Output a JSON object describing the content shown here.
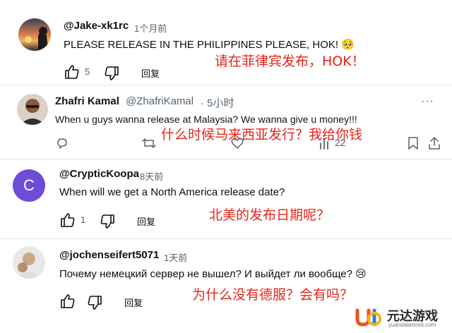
{
  "comments": [
    {
      "handle": "@Jake-xk1rc",
      "time": "1个月前",
      "text": "PLEASE RELEASE IN THE PHILIPPINES PLEASE, HOK! 🥺",
      "translation": "请在菲律宾发布，HOK！",
      "likes": "5",
      "reply_label": "回复"
    },
    {
      "name": "Zhafri Kamal",
      "handle": "@ZhafriKamal",
      "time": "· 5小时",
      "text": "When u guys wanna release at Malaysia? We wanna give u money!!!",
      "translation": "什么时候马来西亚发行？我给你钱",
      "views": "22",
      "more": "···"
    },
    {
      "handle": "@CrypticKoopa",
      "time": "8天前",
      "avatar_letter": "C",
      "text": "When will we get a North America release date?",
      "translation": "北美的发布日期呢？",
      "likes": "1",
      "reply_label": "回复"
    },
    {
      "handle": "@jochenseifert5071",
      "time": "1天前",
      "text": "Почему немецкий сервер не вышел? И выйдет ли вообще? 😢",
      "translation": "为什么没有德服？会有吗？",
      "reply_label": "回复"
    }
  ],
  "watermark": {
    "name": "元达游戏",
    "domain": "yuandalanmid.com"
  },
  "colors": {
    "translation": "#e8231a",
    "avatar_purple": "#6f4cd6",
    "muted": "#606060"
  }
}
